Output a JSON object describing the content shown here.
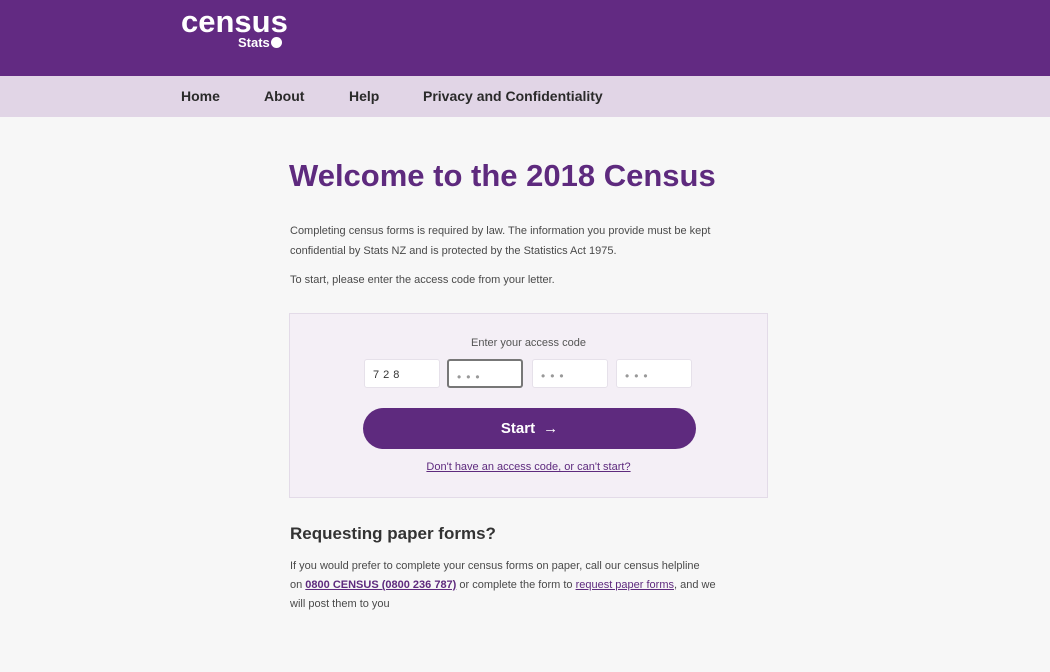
{
  "header": {
    "logo_text": "census",
    "logo_sub": "Stats"
  },
  "nav": {
    "items": [
      {
        "label": "Home"
      },
      {
        "label": "About"
      },
      {
        "label": "Help"
      },
      {
        "label": "Privacy and Confidentiality"
      }
    ]
  },
  "main": {
    "title": "Welcome to the 2018 Census",
    "intro_line1": "Completing census forms is required by law. The information you provide must be kept",
    "intro_line2": "confidential by Stats NZ and is protected by the Statistics Act 1975.",
    "instruction": "To start, please enter the access code from your letter."
  },
  "access": {
    "label": "Enter your access code",
    "fields": [
      {
        "value": "728",
        "placeholder": ""
      },
      {
        "value": "",
        "placeholder": "•••"
      },
      {
        "value": "",
        "placeholder": "•••"
      },
      {
        "value": "",
        "placeholder": "•••"
      }
    ],
    "start_label": "Start",
    "start_arrow": "→",
    "no_code_link": "Don't have an access code, or can't start?"
  },
  "paper": {
    "heading": "Requesting paper forms?",
    "line1": "If you would prefer to complete your census forms on paper, call our census helpline",
    "line2_prefix": "on ",
    "phone_link": "0800 CENSUS (0800 236 787)",
    "line2_mid": " or complete the form to ",
    "request_link": "request paper forms",
    "line2_suffix": ", and we",
    "line3": "will post them to you"
  }
}
